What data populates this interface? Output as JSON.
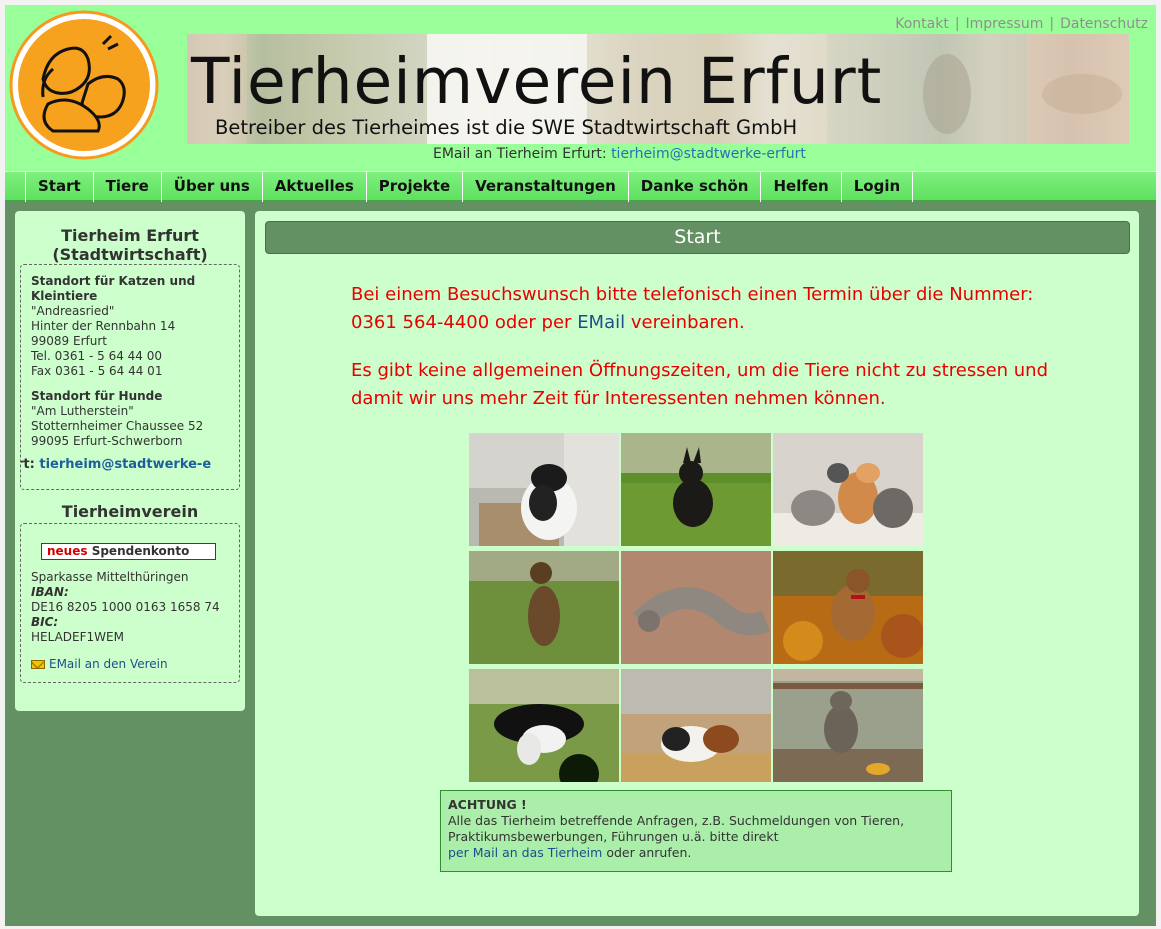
{
  "header": {
    "toplinks": [
      "Kontakt",
      "Impressum",
      "Datenschutz"
    ],
    "title": "Tierheimverein Erfurt",
    "subtitle": "Betreiber des Tierheimes ist die SWE Stadtwirtschaft GmbH",
    "email_prefix": "EMail an Tierheim Erfurt:",
    "email_link": "tierheim@stadtwerke-erfurt"
  },
  "nav": [
    "Start",
    "Tiere",
    "Über uns",
    "Aktuelles",
    "Projekte",
    "Veranstaltungen",
    "Danke schön",
    "Helfen",
    "Login"
  ],
  "sidebar": {
    "title1": "Tierheim Erfurt",
    "title1b": "(Stadtwirtschaft)",
    "cats_heading": "Standort für Katzen und Kleintiere",
    "cats_lines": [
      "\"Andreasried\"",
      "Hinter der Rennbahn 14",
      "99089 Erfurt",
      "Tel. 0361 - 5 64 44 00",
      "Fax 0361 - 5 64 44 01"
    ],
    "dogs_heading": "Standort für Hunde",
    "dogs_lines": [
      "\"Am Lutherstein\"",
      "Stotternheimer Chaussee 52",
      "99095 Erfurt-Schwerborn"
    ],
    "mail_prefix": "rt:",
    "mail_link": "tierheim@stadtwerke-e",
    "title2": "Tierheimverein",
    "spende_new": "neues",
    "spende_rest": "Spendenkonto",
    "bank": "Sparkasse Mittelthüringen",
    "iban_label": "IBAN:",
    "iban": "DE16 8205 1000 0163 1658 74",
    "bic_label": "BIC:",
    "bic": "HELADEF1WEM",
    "verein_mail": "EMail an den Verein"
  },
  "content": {
    "heading": "Start",
    "p1_a": "Bei einem Besuchswunsch bitte telefonisch einen Termin über die Nummer: 0361 564-4400 oder per",
    "p1_link": "EMail",
    "p1_b": "vereinbaren.",
    "p2": "Es gibt keine allgemeinen Öffnungszeiten, um die Tiere nicht zu stressen und damit wir uns mehr Zeit für Interessenten nehmen können.",
    "achtung_title": "ACHTUNG !",
    "achtung_text": "Alle das Tierheim betreffende Anfragen, z.B. Suchmeldungen von Tieren, Praktikumsbewerbungen, Führungen u.ä. bitte direkt",
    "achtung_link": "per Mail an das Tierheim",
    "achtung_tail": "oder anrufen."
  },
  "colors": {
    "page_bg": "#649164",
    "header_bg": "#99ff99",
    "panel_bg": "#ccffcc",
    "warning_red": "#e80000"
  }
}
